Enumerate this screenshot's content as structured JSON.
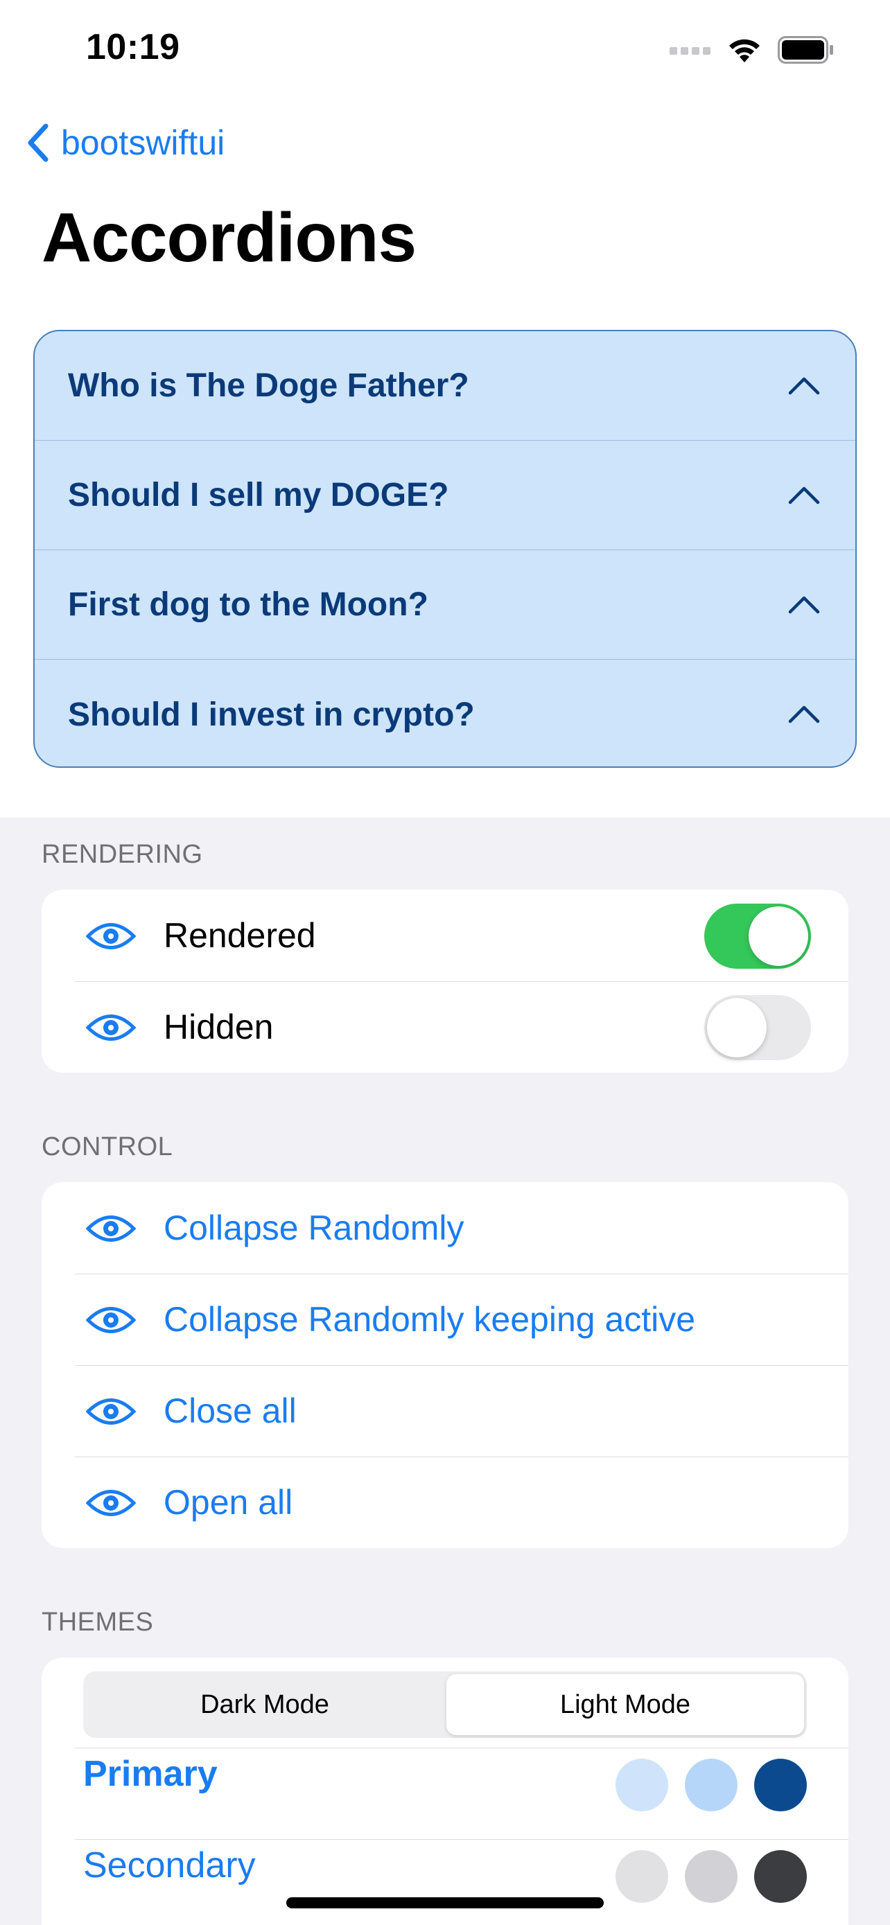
{
  "status_bar": {
    "time": "10:19"
  },
  "nav": {
    "back_label": "bootswiftui",
    "title": "Accordions"
  },
  "accordion": {
    "items": [
      {
        "label": "Who is The Doge Father?"
      },
      {
        "label": "Should I sell my DOGE?"
      },
      {
        "label": "First dog to the Moon?"
      },
      {
        "label": "Should I invest in crypto?"
      }
    ]
  },
  "rendering": {
    "header": "RENDERING",
    "rows": [
      {
        "label": "Rendered",
        "toggle_on": true
      },
      {
        "label": "Hidden",
        "toggle_on": false
      }
    ]
  },
  "control": {
    "header": "CONTROL",
    "rows": [
      {
        "label": "Collapse Randomly"
      },
      {
        "label": "Collapse Randomly keeping active"
      },
      {
        "label": "Close all"
      },
      {
        "label": "Open all"
      }
    ]
  },
  "themes": {
    "header": "THEMES",
    "segments": [
      "Dark Mode",
      "Light Mode"
    ],
    "selected_segment": "Light Mode",
    "rows": [
      {
        "label": "Primary",
        "colors": [
          "#cfe4fb",
          "#b6d6f9",
          "#0b4a8e"
        ]
      },
      {
        "label": "Secondary",
        "colors": [
          "#e1e1e3",
          "#d2d2d6",
          "#3c3d40"
        ]
      }
    ]
  },
  "colors": {
    "accent": "#1a7cf0",
    "toggle_on": "#34c759",
    "accordion_bg": "#cde4fb",
    "accordion_text": "#0b3a78"
  }
}
